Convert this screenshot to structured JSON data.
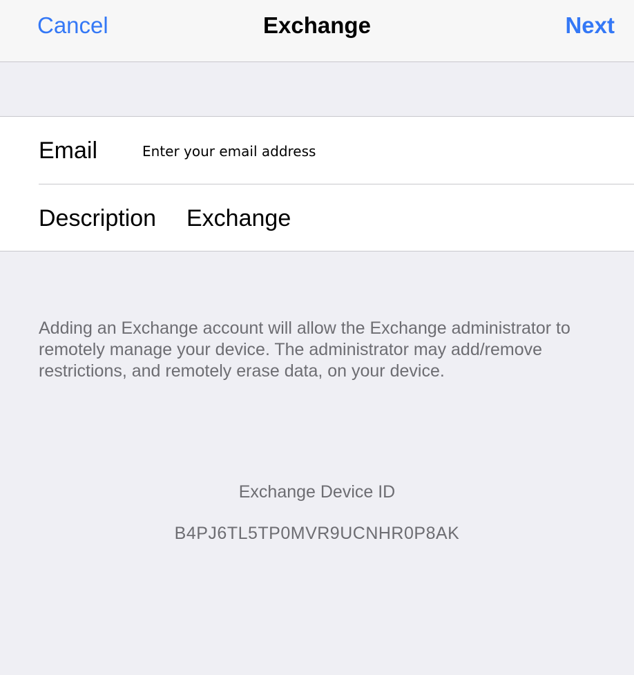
{
  "navbar": {
    "cancel_label": "Cancel",
    "title": "Exchange",
    "next_label": "Next"
  },
  "form": {
    "email": {
      "label": "Email",
      "value": "",
      "placeholder": "Enter your email address"
    },
    "description": {
      "label": "Description",
      "value": "Exchange"
    }
  },
  "footer": {
    "notice": "Adding an Exchange account will allow the Exchange administrator to remotely manage your device. The administrator may add/remove restrictions, and remotely erase data, on your device.",
    "device_id_label": "Exchange Device ID",
    "device_id_value": "B4PJ6TL5TP0MVR9UCNHR0P8AK"
  },
  "colors": {
    "tint": "#3478f6",
    "background": "#efeff4",
    "secondary_text": "#6d6d72"
  }
}
